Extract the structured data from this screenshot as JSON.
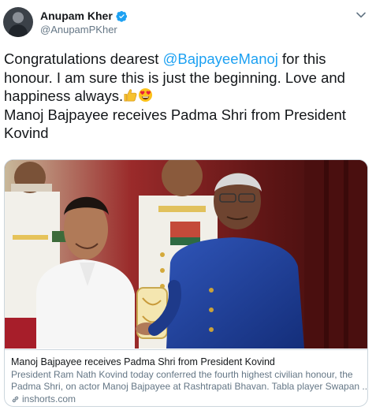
{
  "user": {
    "display_name": "Anupam Kher",
    "handle": "@AnupamPKher",
    "verified_icon": "verified-badge-icon"
  },
  "tweet": {
    "line1_pre": "Congratulations dearest ",
    "mention": "@BajpayeeManoj",
    "line1_post": " for this",
    "line2": "honour. I am sure this is just the beginning. Love and",
    "line3": "happiness always.",
    "emojis": [
      "thumbs-up-icon",
      "heart-eyes-icon"
    ],
    "line4": " Manoj Bajpayee receives Padma Shri from President",
    "line5": "Kovind"
  },
  "card": {
    "title": "Manoj Bajpayee receives Padma Shri from President Kovind",
    "desc_line1": "President Ram Nath Kovind today conferred the fourth highest civilian honour, the",
    "desc_line2": "Padma Shri, on actor Manoj Bajpayee at Rashtrapati Bhavan. Tabla player Swapan ...",
    "domain": "inshorts.com"
  },
  "colors": {
    "accent": "#1da1f2",
    "secondary_text": "#657786",
    "border": "#ccd6dd"
  }
}
